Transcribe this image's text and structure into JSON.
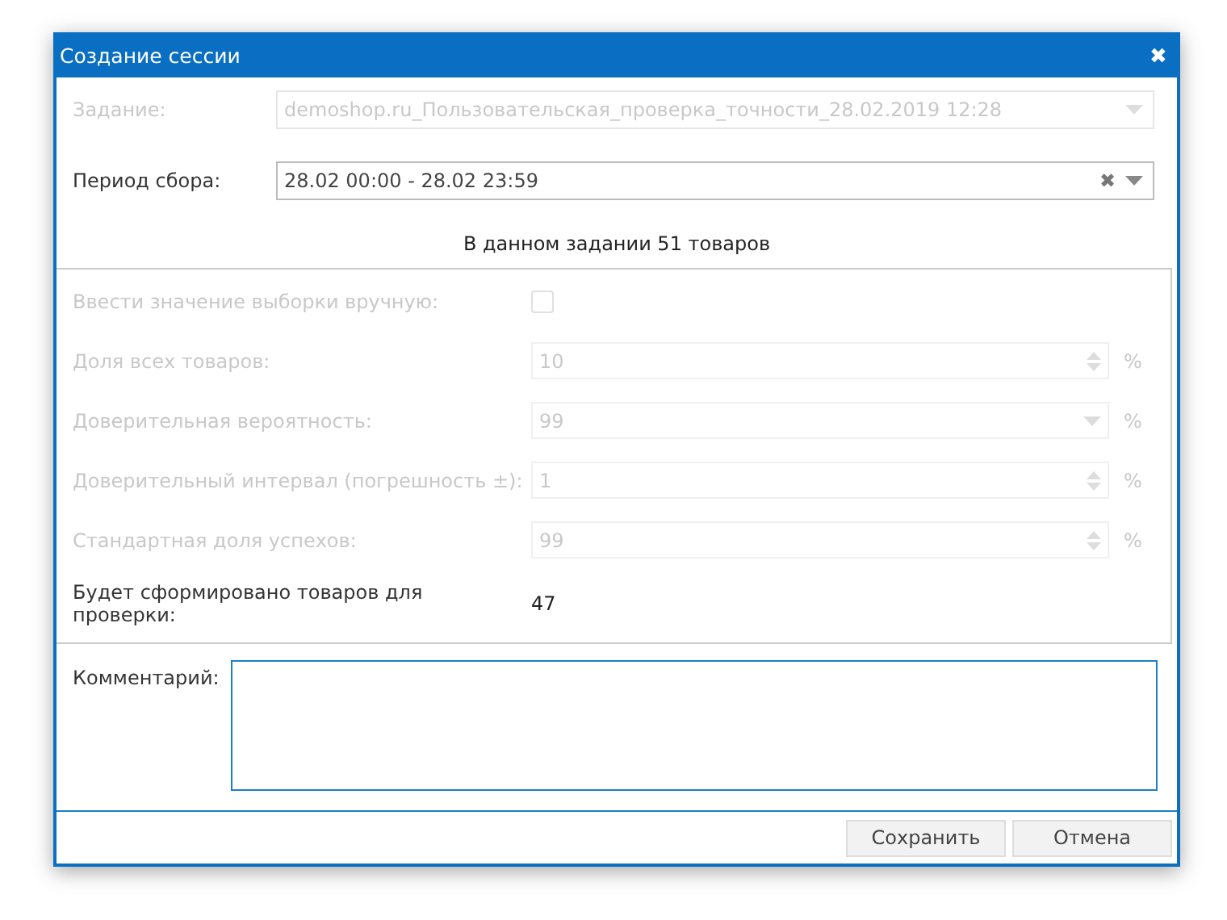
{
  "window": {
    "title": "Создание сессии",
    "close": "✖"
  },
  "task": {
    "label": "Задание:",
    "value": "demoshop.ru_Пользовательская_проверка_точности_28.02.2019 12:28",
    "disabled": true
  },
  "period": {
    "label": "Период сбора:",
    "value": "28.02 00:00 - 28.02 23:59",
    "disabled": false,
    "clear": "✖"
  },
  "info": "В данном задании 51 товаров",
  "sample": {
    "rows": [
      {
        "kind": "checkbox",
        "label": "Ввести значение выборки вручную:",
        "checked": false,
        "disabled": true
      },
      {
        "kind": "spinner",
        "label": "Доля всех товаров:",
        "value": "10",
        "unit": "%",
        "disabled": true
      },
      {
        "kind": "select",
        "label": "Доверительная вероятность:",
        "value": "99",
        "unit": "%",
        "disabled": true
      },
      {
        "kind": "spinner",
        "label": "Доверительный интервал (погрешность ±):",
        "value": "1",
        "unit": "%",
        "disabled": true
      },
      {
        "kind": "spinner",
        "label": "Стандартная доля успехов:",
        "value": "99",
        "unit": "%",
        "disabled": true
      }
    ],
    "result": {
      "label": "Будет сформировано товаров для проверки:",
      "value": "47"
    }
  },
  "comment": {
    "label": "Комментарий:"
  },
  "buttons": [
    "Сохранить",
    "Отмена"
  ]
}
